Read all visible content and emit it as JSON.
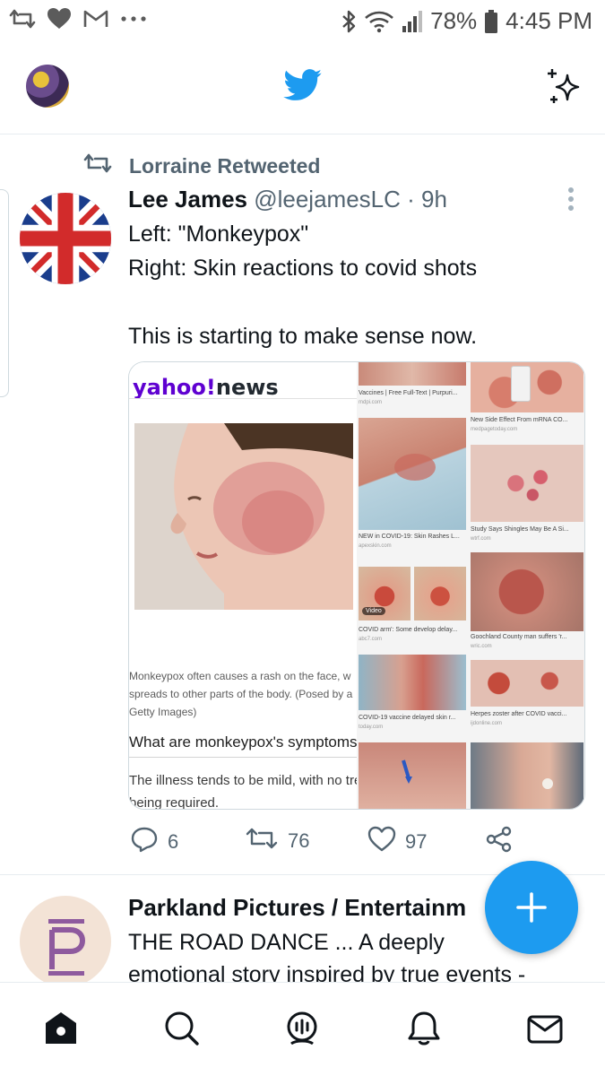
{
  "status_bar": {
    "battery": "78%",
    "time": "4:45 PM",
    "left_icons": [
      "retweet-notification-icon",
      "heart-notification-icon",
      "gmail-icon",
      "more-dots-icon"
    ],
    "right_icons": [
      "bluetooth-icon",
      "wifi-icon",
      "signal-icon",
      "battery-icon"
    ]
  },
  "header": {
    "icons": [
      "profile-avatar",
      "twitter-bird-icon",
      "sparkle-icon"
    ],
    "brand_color": "#1d9bf0"
  },
  "tweet": {
    "retweeted_by": "Lorraine Retweeted",
    "display_name": "Lee James",
    "handle": "@leejamesLC",
    "time": "· 9h",
    "lines": [
      "Left: \"Monkeypox\"",
      "Right: Skin reactions to covid shots",
      "This is starting to make sense now."
    ],
    "media": {
      "logo_yahoo": "yahoo!",
      "logo_news": "news",
      "caption_lines": [
        "Monkeypox often causes a rash on the face, w",
        "spreads to other parts of the body. (Posed by a",
        "Getty Images)"
      ],
      "heading": "What are monkeypox's symptoms",
      "body_lines": [
        "The illness tends to be mild, with no tre",
        "being required."
      ],
      "results": [
        {
          "title": "Vaccines | Free Full-Text | Purpuri...",
          "source": "mdpi.com"
        },
        {
          "title": "New Side Effect From mRNA CO...",
          "source": "medpagetoday.com"
        },
        {
          "title": "NEW in COVID-19: Skin Rashes L...",
          "source": "apexskin.com"
        },
        {
          "title": "Study Says Shingles May Be A Si...",
          "source": "wtrf.com"
        },
        {
          "title": "COVID arm': Some develop delay...",
          "source": "abc7.com"
        },
        {
          "title": "Goochland County man suffers 'r...",
          "source": "wric.com"
        },
        {
          "title": "COVID-19 vaccine delayed skin r...",
          "source": "today.com"
        },
        {
          "title": "Herpes zoster after COVID vacci...",
          "source": "ijdonline.com"
        }
      ],
      "video_label": "Video"
    },
    "actions": {
      "replies": "6",
      "retweets": "76",
      "likes": "97"
    }
  },
  "tweet2": {
    "display_name": "Parkland Pictures / Entertainm",
    "lines": [
      "THE ROAD DANCE ... A deeply",
      "emotional story inspired by true events -"
    ]
  },
  "fab": {
    "label": "+"
  },
  "bottom_nav": [
    "home-icon",
    "search-icon",
    "spaces-icon",
    "notifications-icon",
    "messages-icon"
  ]
}
